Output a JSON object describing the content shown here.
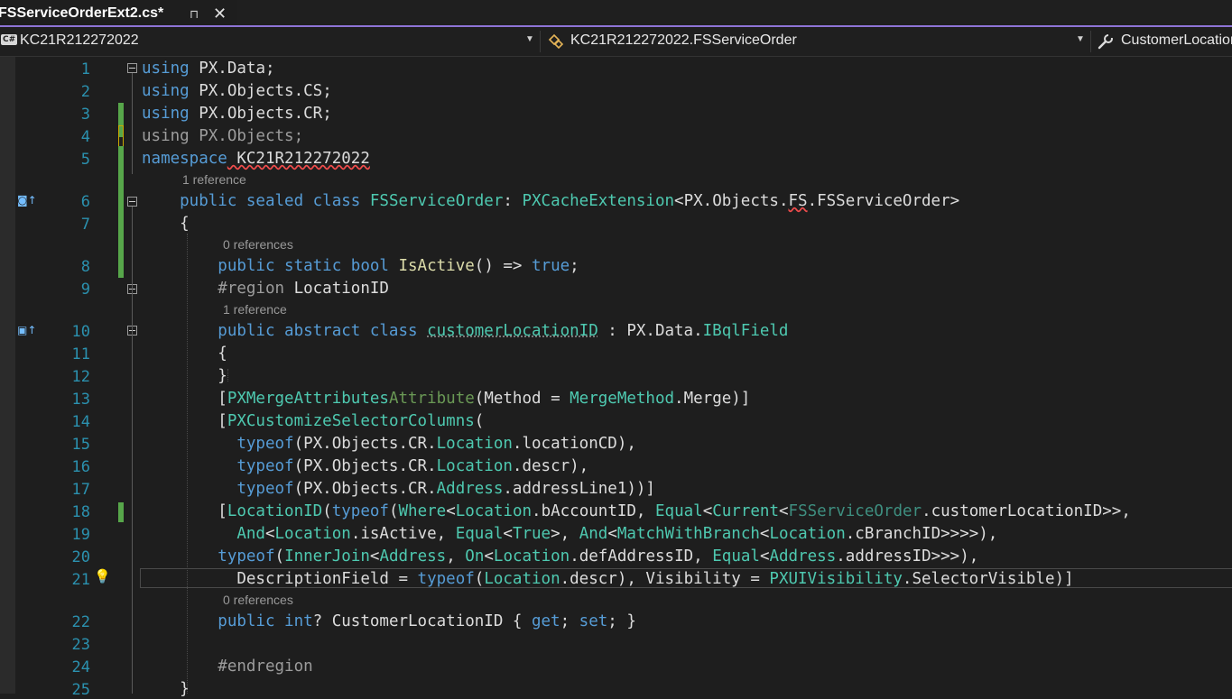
{
  "tab": {
    "title": "FSServiceOrderExt2.cs*",
    "pin": "⊓",
    "close": "✕"
  },
  "nav": {
    "project_icon": "C#",
    "project": "KC21R212272022",
    "class": "KC21R212272022.FSServiceOrder",
    "member": "CustomerLocationID",
    "dropdown_arrow": "▼",
    "class_icon": "class-icon",
    "member_icon": "wrench-icon"
  },
  "line_numbers": [
    "1",
    "2",
    "3",
    "4",
    "5",
    "6",
    "7",
    "8",
    "9",
    "10",
    "11",
    "12",
    "13",
    "14",
    "15",
    "16",
    "17",
    "18",
    "19",
    "20",
    "21",
    "22",
    "23",
    "24",
    "25"
  ],
  "codelens": {
    "l6": "1 reference",
    "l8": "0 references",
    "l10": "1 reference",
    "l22": "0 references"
  },
  "code": {
    "l1_kw": "using",
    "l1_rest": " PX.Data;",
    "l2_kw": "using",
    "l2_rest": " PX.Objects.CS;",
    "l3_kw": "using",
    "l3_rest": " PX.Objects.CR;",
    "l4_text": "using PX.Objects;",
    "l5_kw": "namespace",
    "l5_name": " KC21R212272022",
    "l6_kw": "    public sealed class ",
    "l6_type": "FSServiceOrder",
    "l6_colon": ": ",
    "l6_base": "PXCacheExtension",
    "l6_lt": "<PX.Objects.",
    "l6_fs": "FS",
    "l6_end": ".FSServiceOrder>",
    "l7": "    {",
    "l8_kw": "        public static bool ",
    "l8_fn": "IsActive",
    "l8_mid": "() => ",
    "l8_true": "true",
    "l8_end": ";",
    "l9_dir": "        #region ",
    "l9_name": "LocationID",
    "l10_kw": "        public abstract class ",
    "l10_name": "customerLocationID",
    "l10_mid": " : PX.Data.",
    "l10_type": "IBqlField",
    "l11": "        {",
    "l12": "        }",
    "l13_a": "        [",
    "l13_attr": "PXMergeAttributes",
    "l13_attr2": "Attribute",
    "l13_b": "(Method = ",
    "l13_ty": "MergeMethod",
    "l13_c": ".Merge)]",
    "l14_a": "        [",
    "l14_attr": "PXCustomizeSelectorColumns",
    "l14_b": "(",
    "l15_kw": "          typeof",
    "l15_a": "(PX.Objects.CR.",
    "l15_ty": "Location",
    "l15_b": ".locationCD),",
    "l16_kw": "          typeof",
    "l16_a": "(PX.Objects.CR.",
    "l16_ty": "Location",
    "l16_b": ".descr),",
    "l17_kw": "          typeof",
    "l17_a": "(PX.Objects.CR.",
    "l17_ty": "Address",
    "l17_b": ".addressLine1))]",
    "l18_a": "        [",
    "l18_attr": "LocationID",
    "l18_b": "(",
    "l18_kw": "typeof",
    "l18_c": "(",
    "l18_t1": "Where",
    "l18_d": "<",
    "l18_t2": "Location",
    "l18_e": ".bAccountID, ",
    "l18_t3": "Equal",
    "l18_f": "<",
    "l18_t4": "Current",
    "l18_g": "<",
    "l18_t5": "FSServiceOrder",
    "l18_h": ".customerLocationID>>,",
    "l19_a": "          ",
    "l19_t1": "And",
    "l19_b": "<",
    "l19_t2": "Location",
    "l19_c": ".isActive, ",
    "l19_t3": "Equal",
    "l19_d": "<",
    "l19_t4": "True",
    "l19_e": ">, ",
    "l19_t5": "And",
    "l19_f": "<",
    "l19_t6": "MatchWithBranch",
    "l19_g": "<",
    "l19_t7": "Location",
    "l19_h": ".cBranchID>>>>),",
    "l20_kw": "        typeof",
    "l20_a": "(",
    "l20_t1": "InnerJoin",
    "l20_b": "<",
    "l20_t2": "Address",
    "l20_c": ", ",
    "l20_t3": "On",
    "l20_d": "<",
    "l20_t4": "Location",
    "l20_e": ".defAddressID, ",
    "l20_t5": "Equal",
    "l20_f": "<",
    "l20_t6": "Address",
    "l20_g": ".addressID>>>),",
    "l21_a": "          DescriptionField = ",
    "l21_kw": "typeof",
    "l21_b": "(",
    "l21_t1": "Location",
    "l21_c": ".descr), Visibility = ",
    "l21_t2": "PXUIVisibility",
    "l21_d": ".SelectorVisible)]",
    "l22_kw": "        public int",
    "l22_a": "? CustomerLocationID { ",
    "l22_get": "get",
    "l22_b": "; ",
    "l22_set": "set",
    "l22_c": "; }",
    "l24_dir": "        #endregion",
    "l25": "    }"
  }
}
